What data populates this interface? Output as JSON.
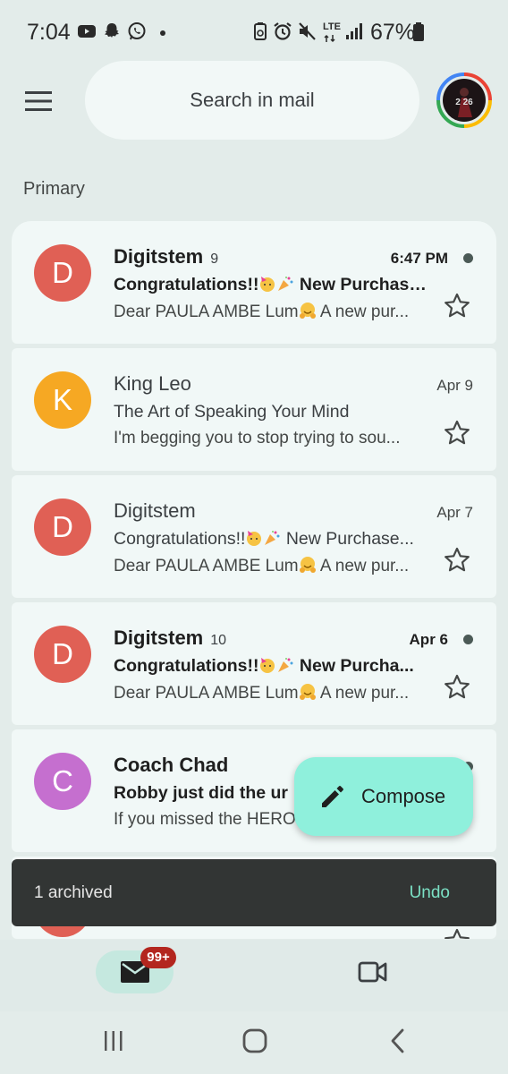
{
  "status_bar": {
    "time": "7:04",
    "battery": "67%",
    "left_icons": [
      "youtube-icon",
      "snapchat-icon",
      "whatsapp-icon",
      "notification-dot-icon"
    ],
    "right_icons": [
      "battery-saver-icon",
      "alarm-icon",
      "mute-icon",
      "lte-icon",
      "signal-icon",
      "battery-icon"
    ],
    "network_label": "LTE"
  },
  "header": {
    "search_placeholder": "Search in mail",
    "avatar_overlay": "2 26"
  },
  "section": {
    "label": "Primary"
  },
  "emails": [
    {
      "avatar_letter": "D",
      "avatar_color": "#e06055",
      "sender": "Digitstem",
      "count": "9",
      "date": "6:47 PM",
      "unread": true,
      "subject_pre": "Congratulations!!",
      "subject_post": " New Purchase...",
      "snippet_pre": "Dear PAULA AMBE Lum",
      "snippet_post": " A new pur..."
    },
    {
      "avatar_letter": "K",
      "avatar_color": "#f6a823",
      "sender": "King Leo",
      "count": "",
      "date": "Apr 9",
      "unread": false,
      "subject_pre": "The Art of Speaking Your Mind",
      "subject_post": "",
      "snippet_pre": "I'm begging you to stop trying to sou...",
      "snippet_post": ""
    },
    {
      "avatar_letter": "D",
      "avatar_color": "#e06055",
      "sender": "Digitstem",
      "count": "",
      "date": "Apr 7",
      "unread": false,
      "subject_pre": "Congratulations!!",
      "subject_post": " New Purchase...",
      "snippet_pre": "Dear PAULA AMBE Lum",
      "snippet_post": " A new pur..."
    },
    {
      "avatar_letter": "D",
      "avatar_color": "#e06055",
      "sender": "Digitstem",
      "count": "10",
      "date": "Apr 6",
      "unread": true,
      "subject_pre": "Congratulations!!",
      "subject_post": " New Purcha...",
      "snippet_pre": "Dear PAULA AMBE Lum",
      "snippet_post": " A new pur..."
    },
    {
      "avatar_letter": "C",
      "avatar_color": "#c56fcf",
      "sender": "Coach Chad",
      "count": "",
      "date": "",
      "unread": true,
      "subject_pre": "Robby just did the ur",
      "subject_post": "",
      "snippet_pre": "If you missed the HERO",
      "snippet_post": ""
    }
  ],
  "compose": {
    "label": "Compose"
  },
  "snackbar": {
    "message": "1 archived",
    "action": "Undo"
  },
  "bottom_nav": {
    "mail_badge": "99+",
    "items": [
      "mail-icon",
      "video-icon"
    ]
  },
  "colors": {
    "background": "#e3ecea",
    "card": "#f1f8f7",
    "compose": "#8ff0dc",
    "snackbar": "#323534",
    "undo": "#7be0c4",
    "badge": "#b3261e"
  }
}
